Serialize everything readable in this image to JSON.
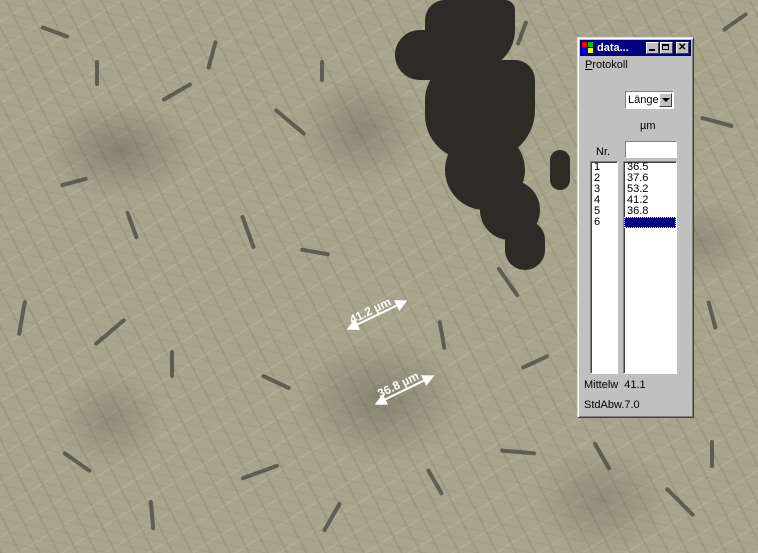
{
  "window": {
    "title": "data...",
    "icon": "app-icon",
    "buttons": [
      "minimize",
      "maximize",
      "close"
    ]
  },
  "menu": {
    "first_letter": "P",
    "rest": "rotokoll"
  },
  "measurement_type": {
    "selected": "Länge"
  },
  "unit": "µm",
  "list": {
    "nr_header": "Nr.",
    "rows": [
      {
        "nr": "1",
        "value": "36.5"
      },
      {
        "nr": "2",
        "value": "37.6"
      },
      {
        "nr": "3",
        "value": "53.2"
      },
      {
        "nr": "4",
        "value": "41.2"
      },
      {
        "nr": "5",
        "value": "36.8"
      },
      {
        "nr": "6",
        "value": ""
      }
    ]
  },
  "stats": {
    "mean_label": "Mittelw",
    "mean_value": "41.1",
    "std_label": "StdAbw.",
    "std_value": "7.0"
  },
  "annotations": [
    {
      "label": "41.2 µm"
    },
    {
      "label": "36.8 µm"
    }
  ],
  "colors": {
    "titlebar": "#000080",
    "window_face": "#c0c0c0",
    "measure_line": "#ffffff"
  }
}
